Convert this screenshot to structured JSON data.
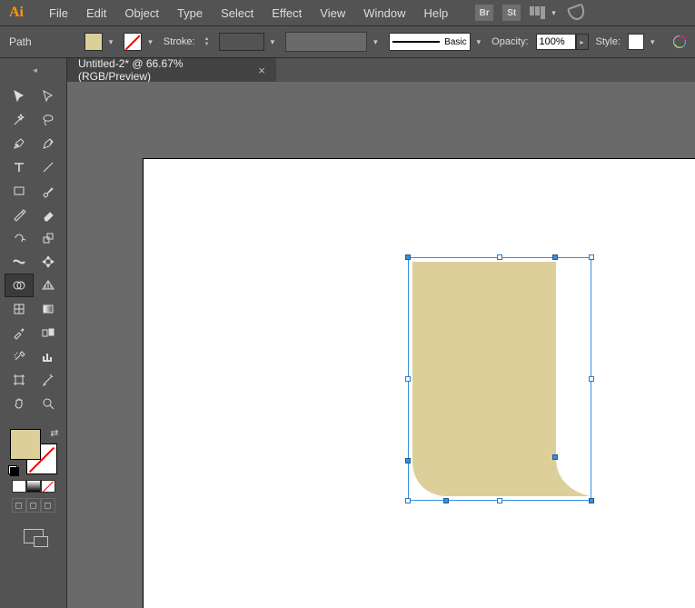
{
  "app": {
    "name": "Ai"
  },
  "menu": {
    "items": [
      "File",
      "Edit",
      "Object",
      "Type",
      "Select",
      "Effect",
      "View",
      "Window",
      "Help"
    ],
    "chips": {
      "br": "Br",
      "st": "St"
    }
  },
  "control": {
    "selection_label": "Path",
    "stroke_label": "Stroke:",
    "brush_label": "Basic",
    "opacity_label": "Opacity:",
    "opacity_value": "100%",
    "style_label": "Style:"
  },
  "tab": {
    "title": "Untitled-2* @ 66.67% (RGB/Preview)",
    "close": "×"
  },
  "tools": [
    "selection",
    "direct-selection",
    "magic-wand",
    "lasso",
    "pen",
    "curvature",
    "type",
    "line-segment",
    "rectangle",
    "paintbrush",
    "shaper",
    "eraser",
    "rotate",
    "scale",
    "width",
    "free-transform",
    "shape-builder",
    "perspective-grid",
    "mesh",
    "gradient",
    "eyedropper",
    "blend",
    "symbol-sprayer",
    "column-graph",
    "artboard",
    "slice",
    "hand",
    "zoom"
  ],
  "colors": {
    "fill": "#dccf9a",
    "stroke_none": true
  },
  "shape": {
    "fill": "#dccf9a"
  }
}
